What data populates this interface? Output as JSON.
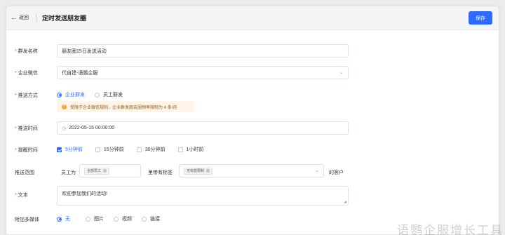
{
  "header": {
    "back_label": "返回",
    "title": "定时发送朋友圈",
    "save_label": "保存"
  },
  "form": {
    "group_name": {
      "label": "群发名称",
      "value": "朋友圈15日发送活动"
    },
    "wecom": {
      "label": "企业微信",
      "value": "代自建-语鹦企服"
    },
    "push_method": {
      "label": "推送方式",
      "options": [
        "企业群发",
        "员工群发"
      ],
      "selected": "企业群发",
      "notice": "受限于企业微信规则，企业群发朋友圈频率限制为 4 条/月"
    },
    "push_time": {
      "label": "推送时间",
      "value": "2022-05-15 00:00:00"
    },
    "remind_time": {
      "label": "提醒时间",
      "options": [
        "5分钟前",
        "15分钟前",
        "30分钟前",
        "1小时前"
      ],
      "checked": [
        "5分钟前"
      ]
    },
    "push_scope": {
      "label": "推送范围",
      "employee_label": "员工为",
      "employee_tag": "全部员工",
      "tags_label": "里带有标签",
      "tag_value": "无标签限制",
      "suffix": "的客户"
    },
    "text": {
      "label": "文本",
      "value": "欢迎参加我们的活动!"
    },
    "media": {
      "label": "附加多媒体",
      "options": [
        "无",
        "图片",
        "视频",
        "链接"
      ],
      "selected": "无"
    }
  },
  "watermark": "语鹦企服增长工具",
  "colors": {
    "accent": "#2d6bff",
    "required": "#ff4d4f",
    "notice_bg": "#fff4e5",
    "warn": "#f7a540"
  },
  "icons": [
    "back-arrow-icon",
    "chevron-down-icon",
    "calendar-icon",
    "warning-icon",
    "close-icon"
  ]
}
